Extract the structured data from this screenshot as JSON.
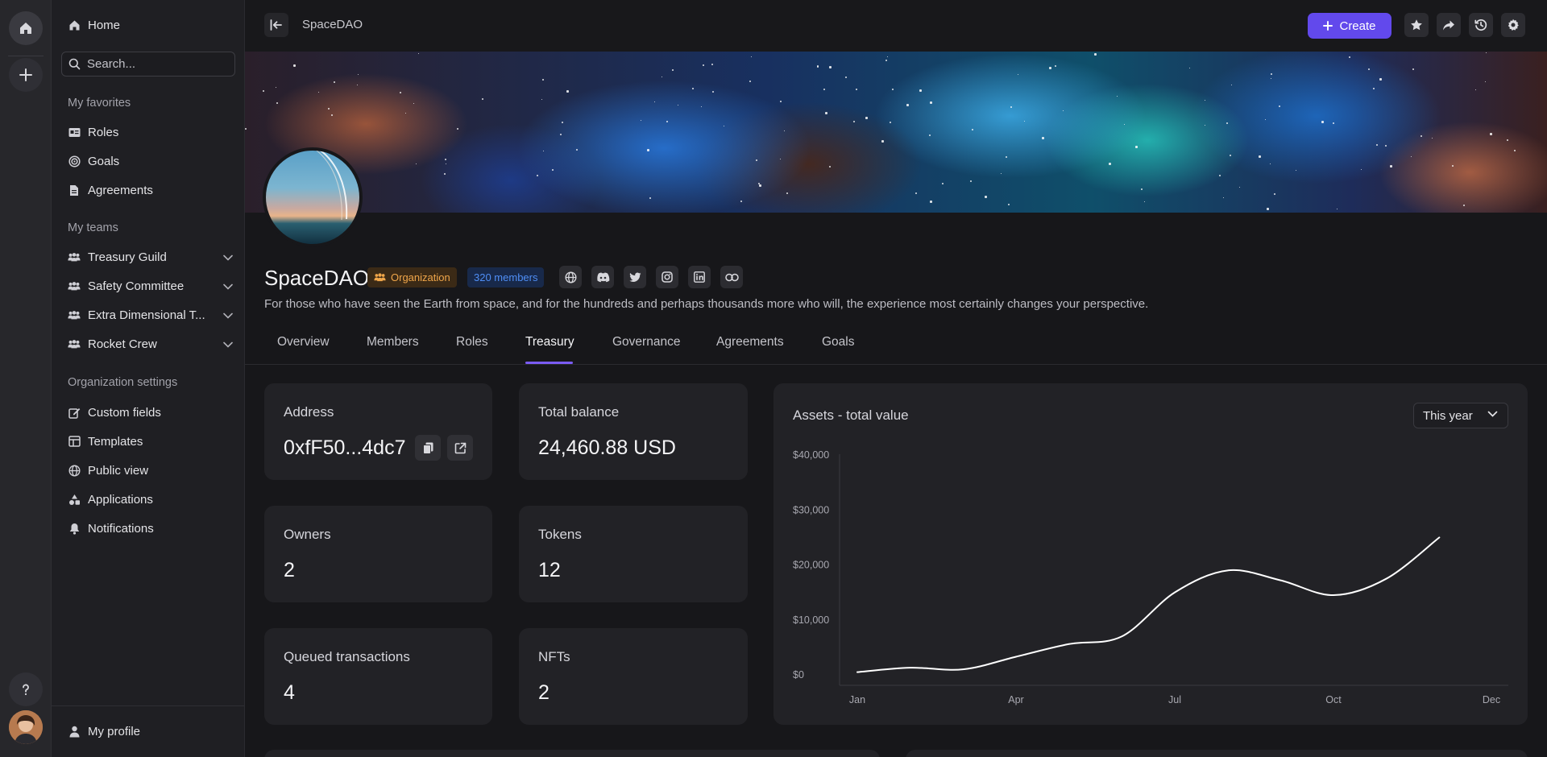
{
  "rail": {
    "home_icon": "home-icon",
    "add_icon": "plus-icon",
    "help_icon": "question-icon"
  },
  "sidebar": {
    "home": "Home",
    "search_placeholder": "Search...",
    "favorites_heading": "My favorites",
    "favorites": [
      "Roles",
      "Goals",
      "Agreements"
    ],
    "teams_heading": "My teams",
    "teams": [
      "Treasury Guild",
      "Safety Committee",
      "Extra Dimensional T...",
      "Rocket Crew"
    ],
    "settings_heading": "Organization settings",
    "settings": [
      "Custom fields",
      "Templates",
      "Public view",
      "Applications",
      "Notifications"
    ],
    "my_profile": "My profile"
  },
  "topbar": {
    "breadcrumb": "SpaceDAO",
    "create_label": "Create"
  },
  "org": {
    "name": "SpaceDAO",
    "type_badge": "Organization",
    "members_badge": "320 members",
    "description": "For those who have seen the Earth from space, and for the hundreds and perhaps thousands more who will, the experience most certainly changes your perspective."
  },
  "tabs": [
    "Overview",
    "Members",
    "Roles",
    "Treasury",
    "Governance",
    "Agreements",
    "Goals"
  ],
  "active_tab": "Treasury",
  "treasury": {
    "address_label": "Address",
    "address_value": "0xfF50...4dc7",
    "balance_label": "Total balance",
    "balance_value": "24,460.88 USD",
    "owners_label": "Owners",
    "owners_value": "2",
    "tokens_label": "Tokens",
    "tokens_value": "12",
    "queued_label": "Queued transactions",
    "queued_value": "4",
    "nfts_label": "NFTs",
    "nfts_value": "2"
  },
  "chart": {
    "title": "Assets - total value",
    "range_select": "This year"
  },
  "chart_data": {
    "type": "line",
    "title": "Assets - total value",
    "xlabel": "",
    "ylabel": "",
    "x_tick_labels": [
      "Jan",
      "Apr",
      "Jul",
      "Oct",
      "Dec"
    ],
    "y_tick_labels": [
      "$40,000",
      "$30,000",
      "$20,000",
      "$10,000",
      "$0"
    ],
    "ylim": [
      0,
      40000
    ],
    "x": [
      0,
      0.5,
      1,
      1.5,
      2,
      2.5,
      3,
      3.5,
      4,
      4.5,
      5,
      5.5
    ],
    "series": [
      {
        "values": [
          500,
          1300,
          1000,
          3300,
          5600,
          7000,
          15000,
          19000,
          17200,
          14500,
          17500,
          25000
        ]
      }
    ],
    "grid": false,
    "line_color": "#ffffff"
  }
}
